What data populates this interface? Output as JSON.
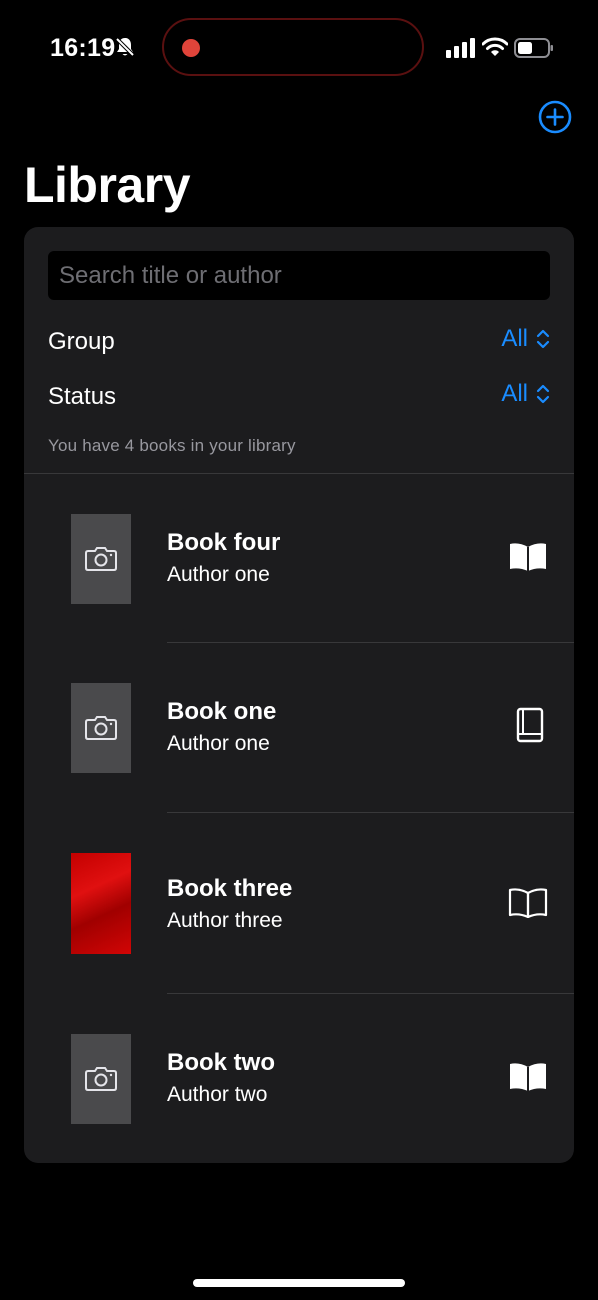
{
  "status_bar": {
    "time": "16:19",
    "icons": [
      "bell-slash-icon",
      "recording-dot-icon",
      "cellular-signal-icon",
      "wifi-icon",
      "battery-icon"
    ],
    "recording_color": "#e0443a"
  },
  "header": {
    "title": "Library",
    "add_icon": "plus-circle-icon"
  },
  "search": {
    "placeholder": "Search title or author",
    "value": ""
  },
  "filters": {
    "group": {
      "label": "Group",
      "value": "All"
    },
    "status": {
      "label": "Status",
      "value": "All"
    }
  },
  "summary": "You have 4 books in your library",
  "books": [
    {
      "title": "Book four",
      "author": "Author one",
      "cover": "camera-placeholder-icon",
      "status_icon": "book-open-filled-icon"
    },
    {
      "title": "Book one",
      "author": "Author one",
      "cover": "camera-placeholder-icon",
      "status_icon": "book-closed-icon"
    },
    {
      "title": "Book three",
      "author": "Author three",
      "cover": "red-cover-image",
      "status_icon": "book-open-outline-icon"
    },
    {
      "title": "Book two",
      "author": "Author two",
      "cover": "camera-placeholder-icon",
      "status_icon": "book-open-filled-icon"
    }
  ],
  "colors": {
    "accent": "#1a8cff",
    "background": "#000000",
    "card": "#1c1c1e",
    "secondary_text": "#98989f"
  }
}
